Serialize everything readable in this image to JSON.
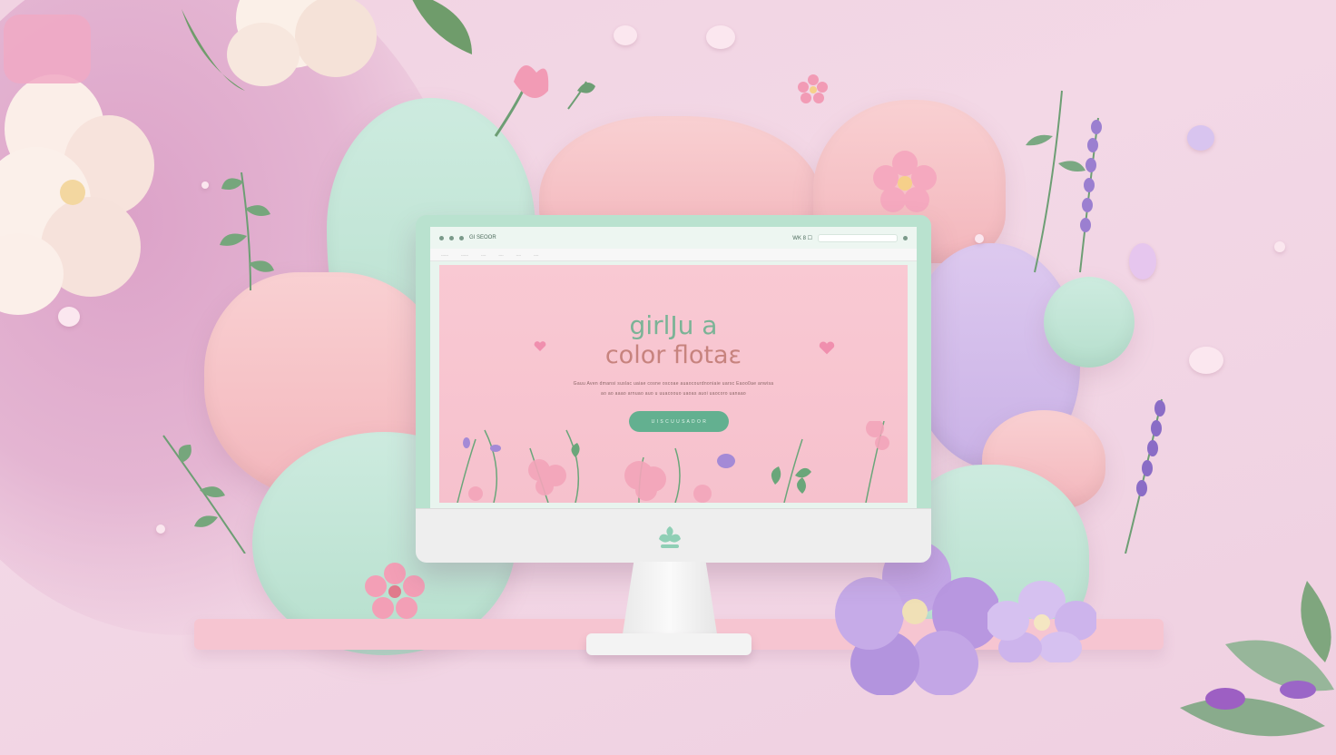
{
  "browser": {
    "tab_title": "GI SEOOR",
    "controls": "WK 8 ☐"
  },
  "nav_tabs": [
    "------",
    "------",
    "----",
    "----",
    "----",
    "----"
  ],
  "hero": {
    "line1": "girlJu a",
    "line2": "color flotaε",
    "subtitle_line1": "Gauu Aven dmansi suslac uaiae cosne oscoae auaocourdnoniaie uarsc Eaoo0ae anwisa",
    "subtitle_line2": "ao ao aaao arnuao auo u uuacoouo uaoas auoi uaocoro uanaao",
    "cta_label": "U I S C  U U S A D O R"
  },
  "colors": {
    "background": "#f1d3e2",
    "mint": "#b6dfcd",
    "pink": "#f3b6bc",
    "lavender": "#c9b1e6",
    "cta": "#63b090"
  },
  "icons": [
    "leaf-logo-icon",
    "browser-menu-icon",
    "search-icon"
  ]
}
